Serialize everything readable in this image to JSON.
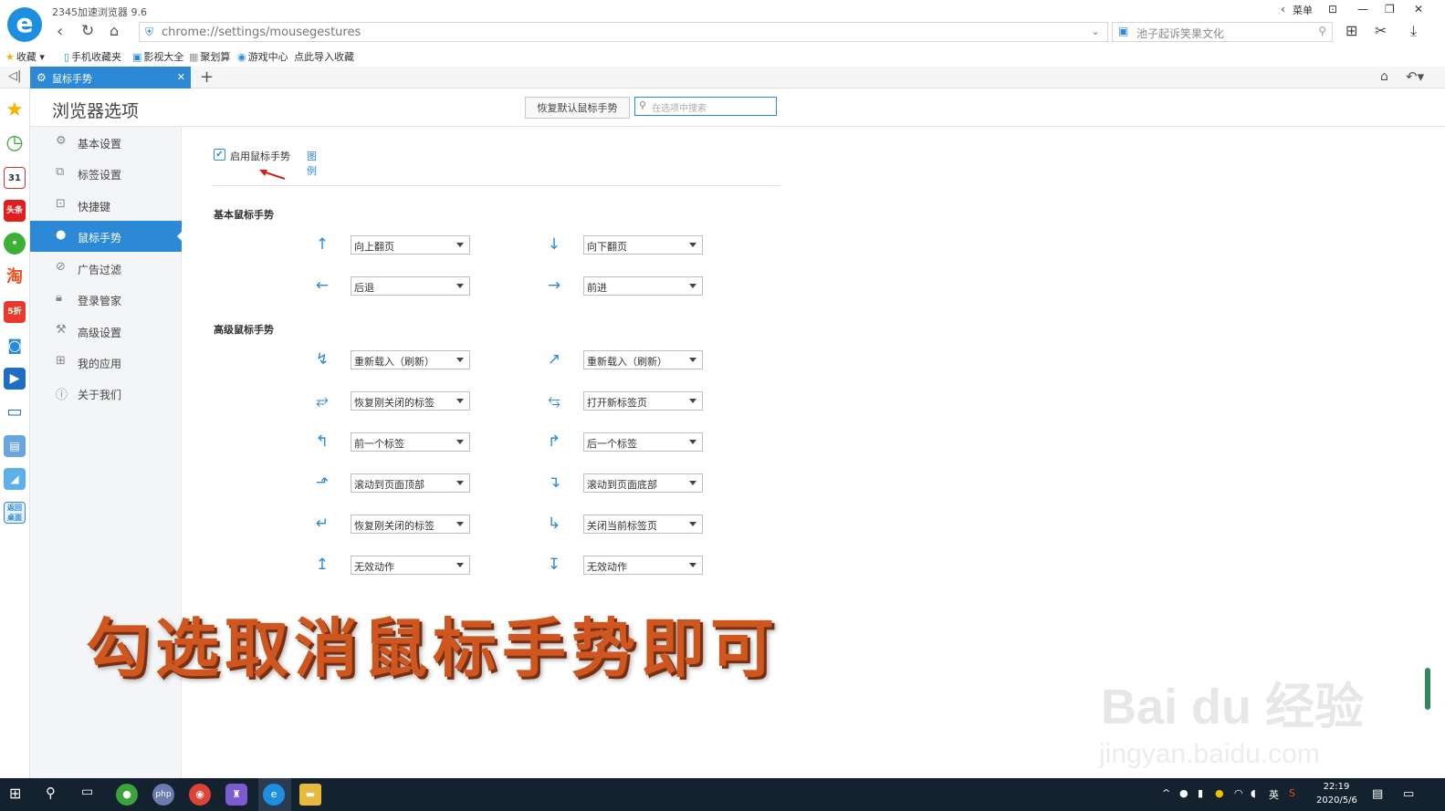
{
  "window": {
    "title": "2345加速浏览器 9.6",
    "menu_label": "菜单"
  },
  "toolbar": {
    "url": "chrome://settings/mousegestures",
    "search_text": "池子起诉笑果文化"
  },
  "bookmarks": [
    "收藏",
    "手机收藏夹",
    "影视大全",
    "聚划算",
    "游戏中心",
    "点此导入收藏"
  ],
  "tab": {
    "label": "鼠标手势"
  },
  "header": {
    "title": "浏览器选项",
    "restore_button": "恢复默认鼠标手势",
    "search_placeholder": "在选项中搜索"
  },
  "sidebar": {
    "items": [
      {
        "label": "基本设置",
        "icon": "gear-icon"
      },
      {
        "label": "标签设置",
        "icon": "tabs-icon"
      },
      {
        "label": "快捷键",
        "icon": "keyboard-icon"
      },
      {
        "label": "鼠标手势",
        "icon": "mouse-icon"
      },
      {
        "label": "广告过滤",
        "icon": "block-icon"
      },
      {
        "label": "登录管家",
        "icon": "lock-icon"
      },
      {
        "label": "高级设置",
        "icon": "wrench-icon"
      },
      {
        "label": "我的应用",
        "icon": "apps-icon"
      },
      {
        "label": "关于我们",
        "icon": "info-icon"
      }
    ]
  },
  "content": {
    "enable_label": "启用鼠标手势",
    "enable_checked": true,
    "legend_link": "图例",
    "basic_title": "基本鼠标手势",
    "advanced_title": "高级鼠标手势",
    "basic": [
      {
        "left": {
          "icon": "↑",
          "value": "向上翻页"
        },
        "right": {
          "icon": "↓",
          "value": "向下翻页"
        }
      },
      {
        "left": {
          "icon": "←",
          "value": "后退"
        },
        "right": {
          "icon": "→",
          "value": "前进"
        }
      }
    ],
    "advanced": [
      {
        "left": {
          "icon": "↯",
          "value": "重新载入（刷新）"
        },
        "right": {
          "icon": "↗",
          "value": "重新载入（刷新）"
        }
      },
      {
        "left": {
          "icon": "⥂",
          "value": "恢复刚关闭的标签"
        },
        "right": {
          "icon": "⥃",
          "value": "打开新标签页"
        }
      },
      {
        "left": {
          "icon": "↰",
          "value": "前一个标签"
        },
        "right": {
          "icon": "↱",
          "value": "后一个标签"
        }
      },
      {
        "left": {
          "icon": "⬏",
          "value": "滚动到页面顶部"
        },
        "right": {
          "icon": "↴",
          "value": "滚动到页面底部"
        }
      },
      {
        "left": {
          "icon": "↵",
          "value": "恢复刚关闭的标签"
        },
        "right": {
          "icon": "↳",
          "value": "关闭当前标签页"
        }
      },
      {
        "left": {
          "icon": "↥",
          "value": "无效动作"
        },
        "right": {
          "icon": "↧",
          "value": "无效动作"
        }
      }
    ]
  },
  "overlay_text": "勾选取消鼠标手势即可",
  "watermark": {
    "line1": "Bai du 经验",
    "line2": "jingyan.baidu.com"
  },
  "taskbar": {
    "time": "22:19",
    "date": "2020/5/6",
    "ime": "英"
  },
  "colors": {
    "accent": "#2b89d6",
    "overlay": "#d0561f",
    "taskbar": "#14212f"
  }
}
